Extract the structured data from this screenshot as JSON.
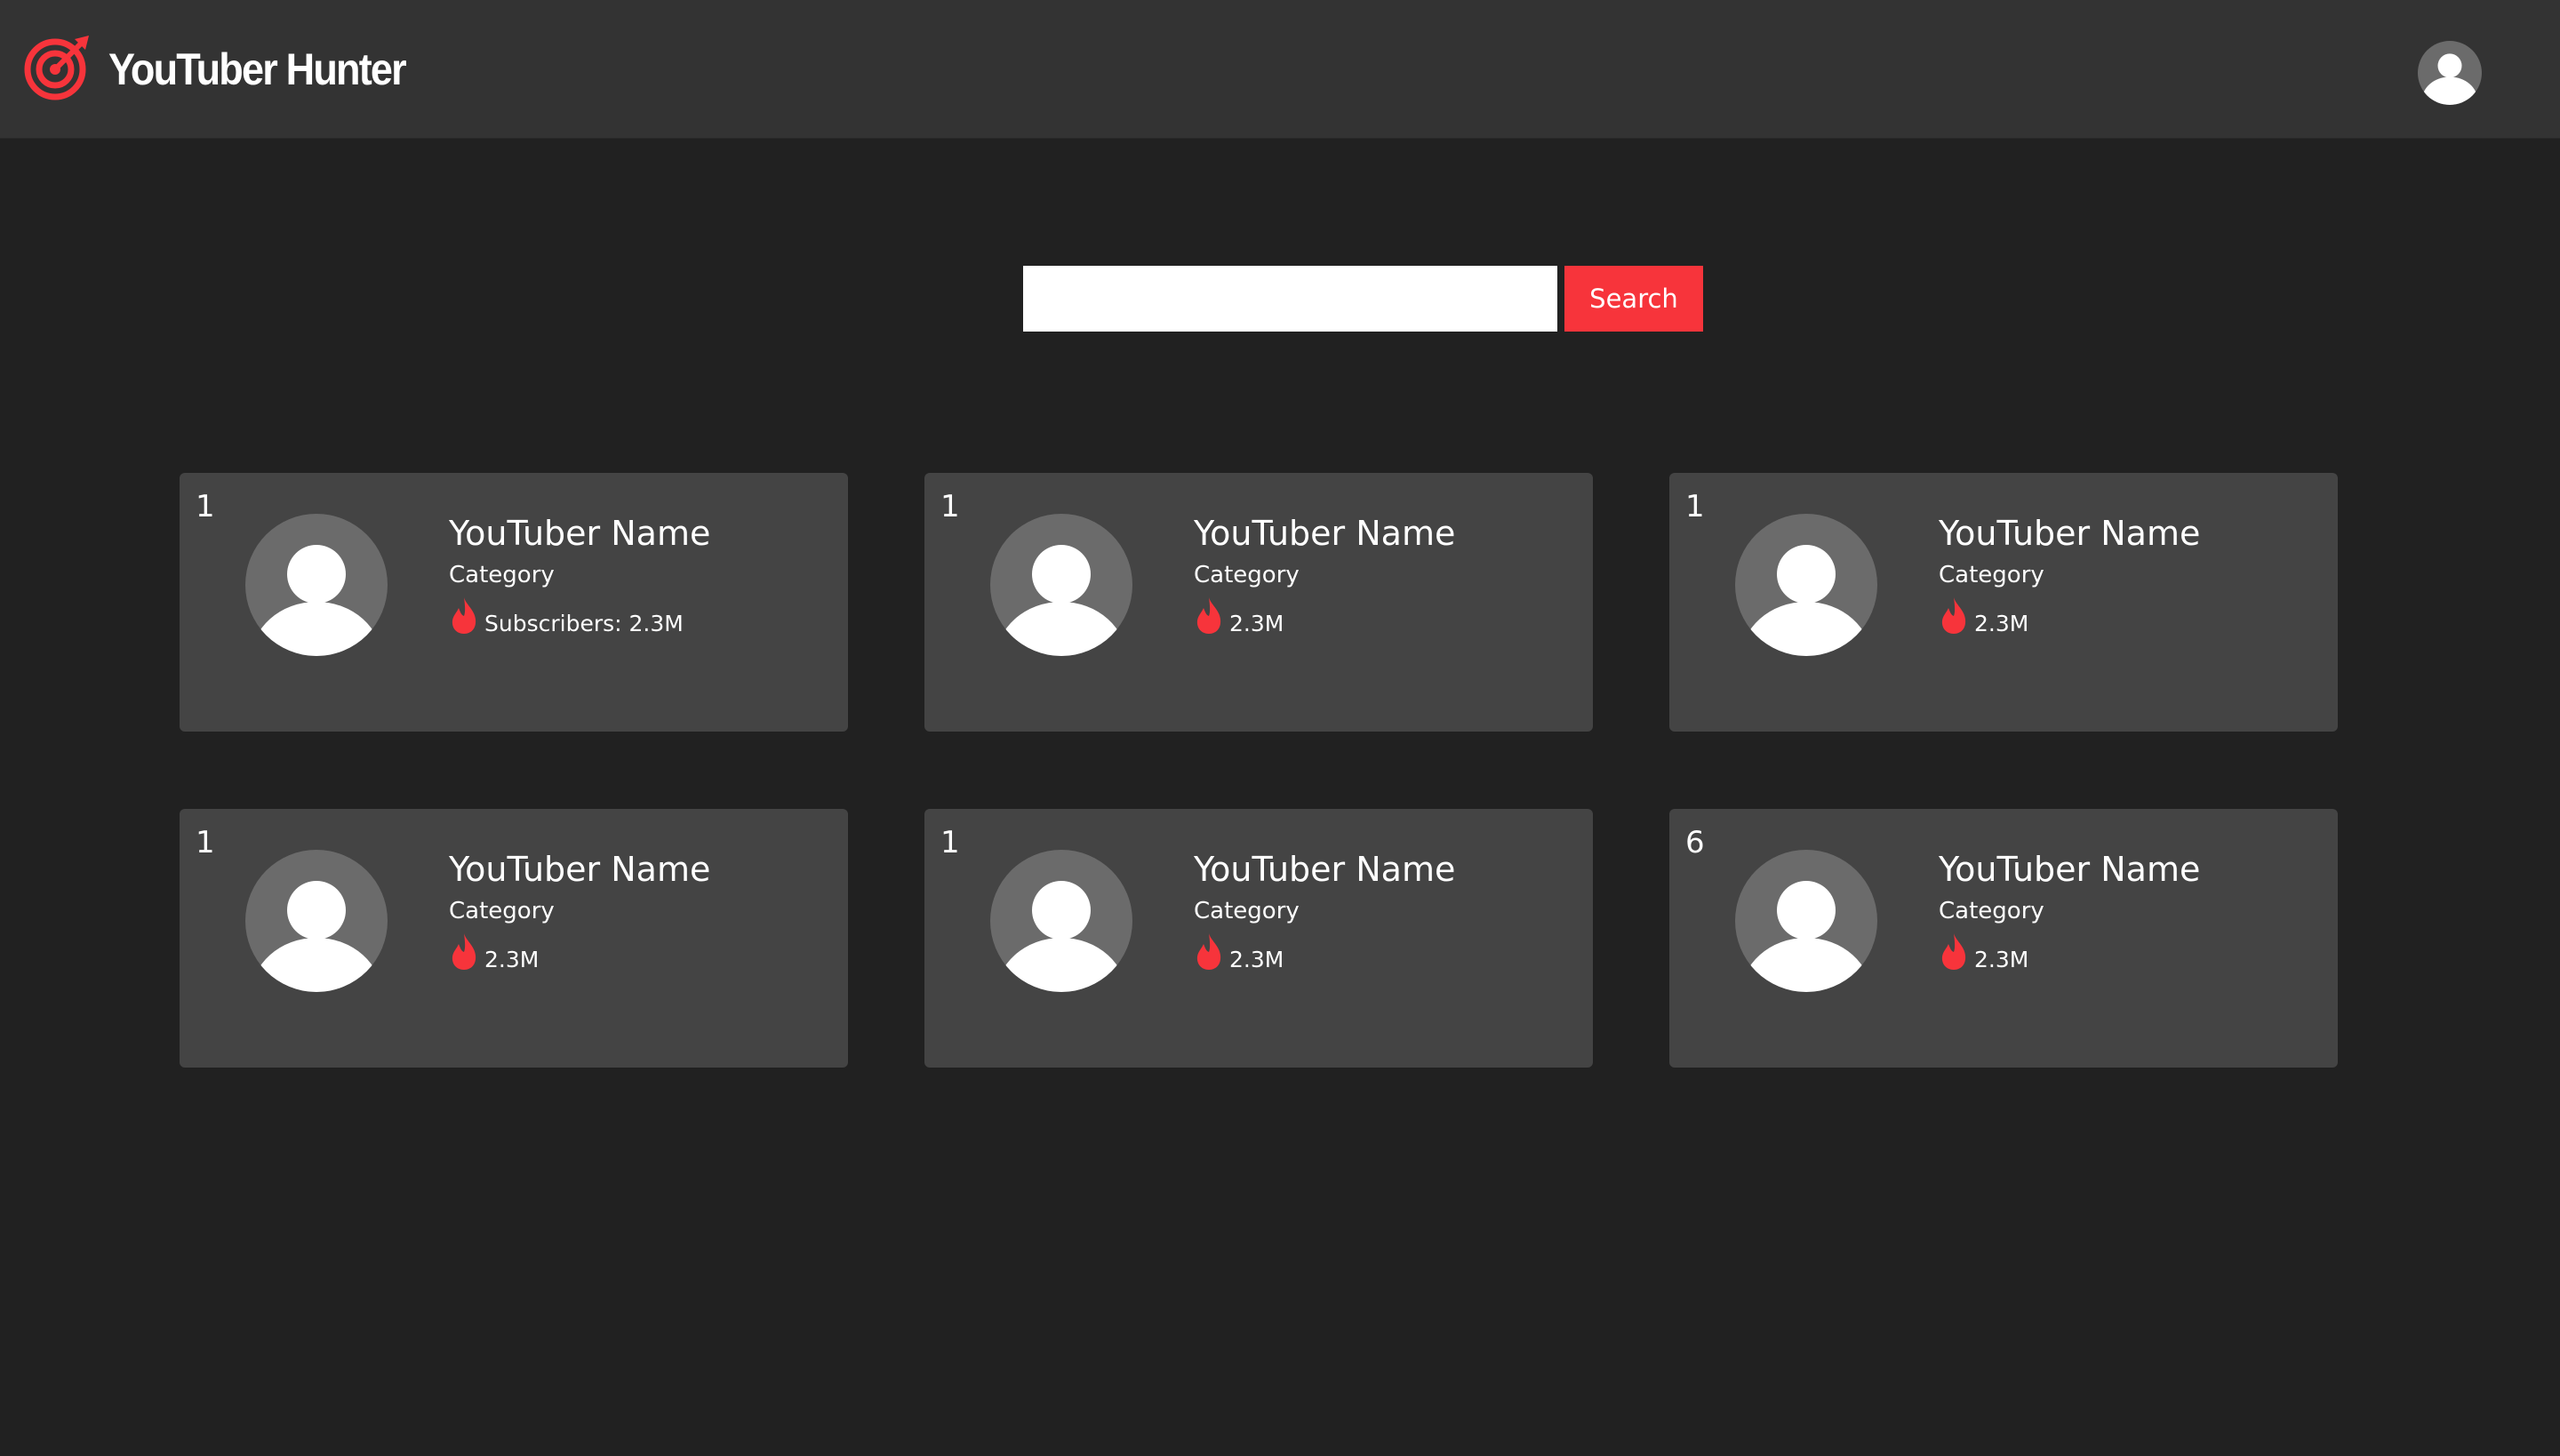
{
  "app": {
    "title": "YouTuber Hunter",
    "accent_color": "#f7343b",
    "logo_icon": "target-icon",
    "user_icon": "user-avatar-icon"
  },
  "search": {
    "value": "",
    "placeholder": "",
    "button_label": "Search"
  },
  "cards": [
    {
      "rank": "1",
      "name": "YouTuber Name",
      "category": "Category",
      "stat": "Subscribers: 2.3M",
      "icon": "flame-icon"
    },
    {
      "rank": "1",
      "name": "YouTuber Name",
      "category": "Category",
      "stat": "2.3M",
      "icon": "flame-icon"
    },
    {
      "rank": "1",
      "name": "YouTuber Name",
      "category": "Category",
      "stat": "2.3M",
      "icon": "flame-icon"
    },
    {
      "rank": "1",
      "name": "YouTuber Name",
      "category": "Category",
      "stat": "2.3M",
      "icon": "flame-icon"
    },
    {
      "rank": "1",
      "name": "YouTuber Name",
      "category": "Category",
      "stat": "2.3M",
      "icon": "flame-icon"
    },
    {
      "rank": "6",
      "name": "YouTuber Name",
      "category": "Category",
      "stat": "2.3M",
      "icon": "flame-icon"
    }
  ]
}
